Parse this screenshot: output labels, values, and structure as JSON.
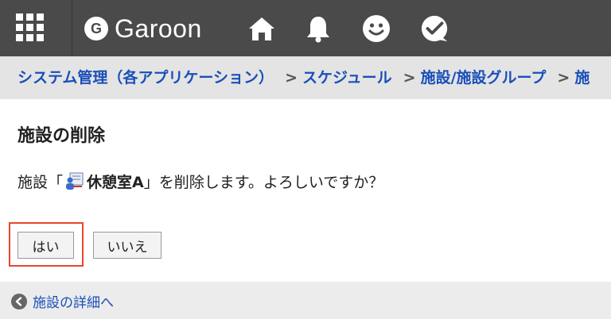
{
  "header": {
    "logo_mark": "G",
    "logo_text": "Garoon",
    "icons": [
      "apps-grid-icon",
      "home-icon",
      "bell-icon",
      "smiley-icon",
      "check-chat-icon"
    ]
  },
  "breadcrumb": [
    {
      "label": "システム管理（各アプリケーション）"
    },
    {
      "label": "スケジュール"
    },
    {
      "label": "施設/施設グループ"
    },
    {
      "label": "施"
    }
  ],
  "main": {
    "title": "施設の削除",
    "message_prefix": "施設「",
    "facility_name": "休憩室A",
    "message_suffix": "」を削除します。よろしいですか？",
    "yes_label": "はい",
    "no_label": "いいえ"
  },
  "footer": {
    "back_label": "施設の詳細へ"
  },
  "colors": {
    "topbar": "#4a4a4a",
    "link": "#1a4fb8",
    "highlight": "#e8472d"
  }
}
